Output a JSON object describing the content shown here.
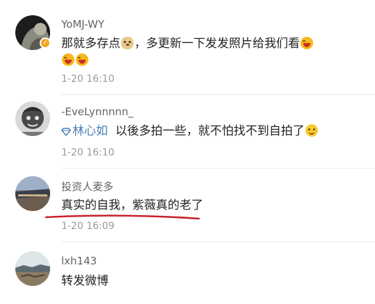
{
  "comments": [
    {
      "username": "YoMJ-WY",
      "text_a": "那就多存点",
      "text_b": "，多更新一下发发照片给我们看",
      "emojis": [
        "doge-icon",
        "laugh-icon",
        "laugh-icon",
        "laugh-icon"
      ],
      "verified": true,
      "time": "1-20 16:10"
    },
    {
      "username": "-EveLynnnnn_",
      "mention": "林心如",
      "text": "以後多拍一些，就不怕找不到自拍了",
      "emojis": [
        "diamond-icon",
        "smile-icon"
      ],
      "time": "1-20 16:10"
    },
    {
      "username": "投资人麦多",
      "text": "真实的自我，紫薇真的老了",
      "time": "1-20 16:09",
      "highlight_color": "#c8202a"
    },
    {
      "username": "lxh143",
      "text": "转发微博"
    }
  ],
  "colors": {
    "text": "#222222",
    "username": "#636363",
    "time": "#9a9a9a",
    "mention": "#4a7fb8",
    "verified_badge": "#f4a623"
  }
}
